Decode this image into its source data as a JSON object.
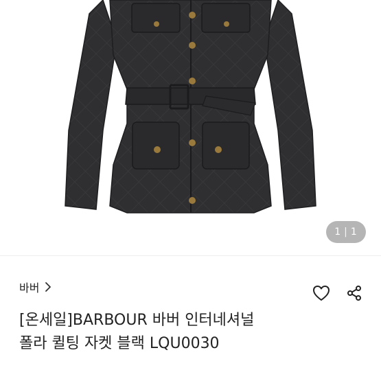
{
  "product": {
    "image_counter": {
      "current": "1",
      "separator": "|",
      "total": "1"
    },
    "brand": {
      "label": "바버"
    },
    "title_line1": "[온세일]BARBOUR 바버 인터네셔널",
    "title_line2": "폴라 퀼팅 자켓 블랙 LQU0030",
    "icons": {
      "brand_chevron": "chevron-right-icon",
      "like": "heart-outline-icon",
      "share": "share-icon"
    }
  },
  "colors": {
    "jacket": "#2f2f31",
    "hardware": "#9a7a3c",
    "text": "#222222"
  }
}
